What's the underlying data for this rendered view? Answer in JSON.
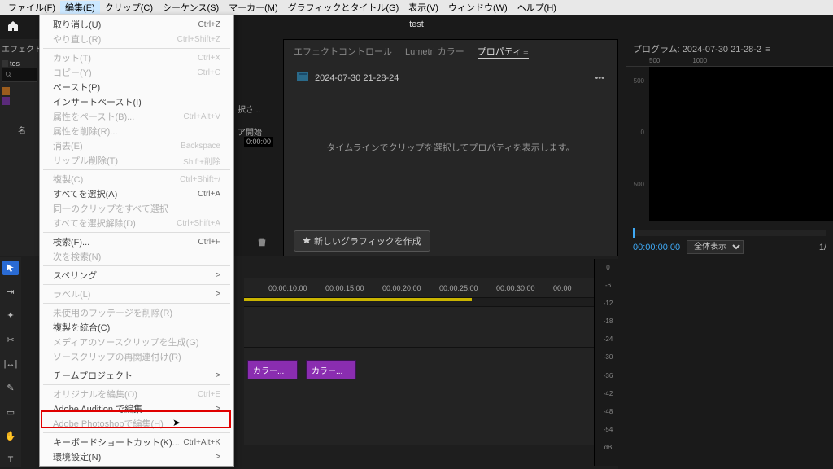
{
  "menubar": {
    "items": [
      "ファイル(F)",
      "編集(E)",
      "クリップ(C)",
      "シーケンス(S)",
      "マーカー(M)",
      "グラフィックとタイトル(G)",
      "表示(V)",
      "ウィンドウ(W)",
      "ヘルプ(H)"
    ]
  },
  "title": "test",
  "effects": {
    "header": "エフェクト",
    "tab": "tes",
    "name_col": "名"
  },
  "truncated": {
    "t1": "択さ...",
    "t2": "ア開始",
    "tc": "0:00:00"
  },
  "props": {
    "tabs": [
      "エフェクトコントロール",
      "Lumetri カラー",
      "プロパティ"
    ],
    "clip_label": "2024-07-30 21-28-24",
    "placeholder": "タイムラインでクリップを選択してプロパティを表示します。",
    "new_graphic": "新しいグラフィックを作成"
  },
  "program": {
    "title": "プログラム: 2024-07-30 21-28-2",
    "ruler": [
      "500",
      "1000"
    ],
    "left_scale": [
      "500",
      "0",
      "500"
    ],
    "timecode": "00:00:00:00",
    "fit": "全体表示",
    "ratio": "1/"
  },
  "timeline": {
    "ticks": [
      "00:00:10:00",
      "00:00:15:00",
      "00:00:20:00",
      "00:00:25:00",
      "00:00:30:00",
      "00:00"
    ],
    "clips": [
      "カラー...",
      "カラー..."
    ]
  },
  "meter": {
    "labels": [
      "0",
      "-6",
      "-12",
      "-18",
      "-24",
      "-30",
      "-36",
      "-42",
      "-48",
      "-54",
      "dB"
    ]
  },
  "edit_menu": [
    {
      "label": "取り消し(U)",
      "sc": "Ctrl+Z",
      "enabled": true
    },
    {
      "label": "やり直し(R)",
      "sc": "Ctrl+Shift+Z",
      "enabled": false
    },
    {
      "sep": true
    },
    {
      "label": "カット(T)",
      "sc": "Ctrl+X",
      "enabled": false
    },
    {
      "label": "コピー(Y)",
      "sc": "Ctrl+C",
      "enabled": false
    },
    {
      "label": "ペースト(P)",
      "sc": "",
      "enabled": true
    },
    {
      "label": "インサートペースト(I)",
      "sc": "",
      "enabled": true
    },
    {
      "label": "属性をペースト(B)...",
      "sc": "Ctrl+Alt+V",
      "enabled": false
    },
    {
      "label": "属性を削除(R)...",
      "sc": "",
      "enabled": false
    },
    {
      "label": "消去(E)",
      "sc": "Backspace",
      "enabled": false
    },
    {
      "label": "リップル削除(T)",
      "sc": "Shift+削除",
      "enabled": false
    },
    {
      "sep": true
    },
    {
      "label": "複製(C)",
      "sc": "Ctrl+Shift+/",
      "enabled": false
    },
    {
      "label": "すべてを選択(A)",
      "sc": "Ctrl+A",
      "enabled": true
    },
    {
      "label": "同一のクリップをすべて選択",
      "sc": "",
      "enabled": false
    },
    {
      "label": "すべてを選択解除(D)",
      "sc": "Ctrl+Shift+A",
      "enabled": false
    },
    {
      "sep": true
    },
    {
      "label": "検索(F)...",
      "sc": "Ctrl+F",
      "enabled": true
    },
    {
      "label": "次を検索(N)",
      "sc": "",
      "enabled": false
    },
    {
      "sep": true
    },
    {
      "label": "スペリング",
      "sc": "",
      "enabled": true,
      "sub": true
    },
    {
      "sep": true
    },
    {
      "label": "ラベル(L)",
      "sc": "",
      "enabled": false,
      "sub": true
    },
    {
      "sep": true
    },
    {
      "label": "未使用のフッテージを削除(R)",
      "sc": "",
      "enabled": false
    },
    {
      "label": "複製を統合(C)",
      "sc": "",
      "enabled": true
    },
    {
      "label": "メディアのソースクリップを生成(G)",
      "sc": "",
      "enabled": false
    },
    {
      "label": "ソースクリップの再関連付け(R)",
      "sc": "",
      "enabled": false
    },
    {
      "sep": true
    },
    {
      "label": "チームプロジェクト",
      "sc": "",
      "enabled": true,
      "sub": true
    },
    {
      "sep": true
    },
    {
      "label": "オリジナルを編集(O)",
      "sc": "Ctrl+E",
      "enabled": false
    },
    {
      "label": "Adobe Audition で編集",
      "sc": "",
      "enabled": true,
      "sub": true
    },
    {
      "label": "Adobe Photoshopで編集(H)",
      "sc": "",
      "enabled": false
    },
    {
      "sep": true
    },
    {
      "label": "キーボードショートカット(K)...",
      "sc": "Ctrl+Alt+K",
      "enabled": true
    },
    {
      "label": "環境設定(N)",
      "sc": "",
      "enabled": true,
      "sub": true
    }
  ]
}
